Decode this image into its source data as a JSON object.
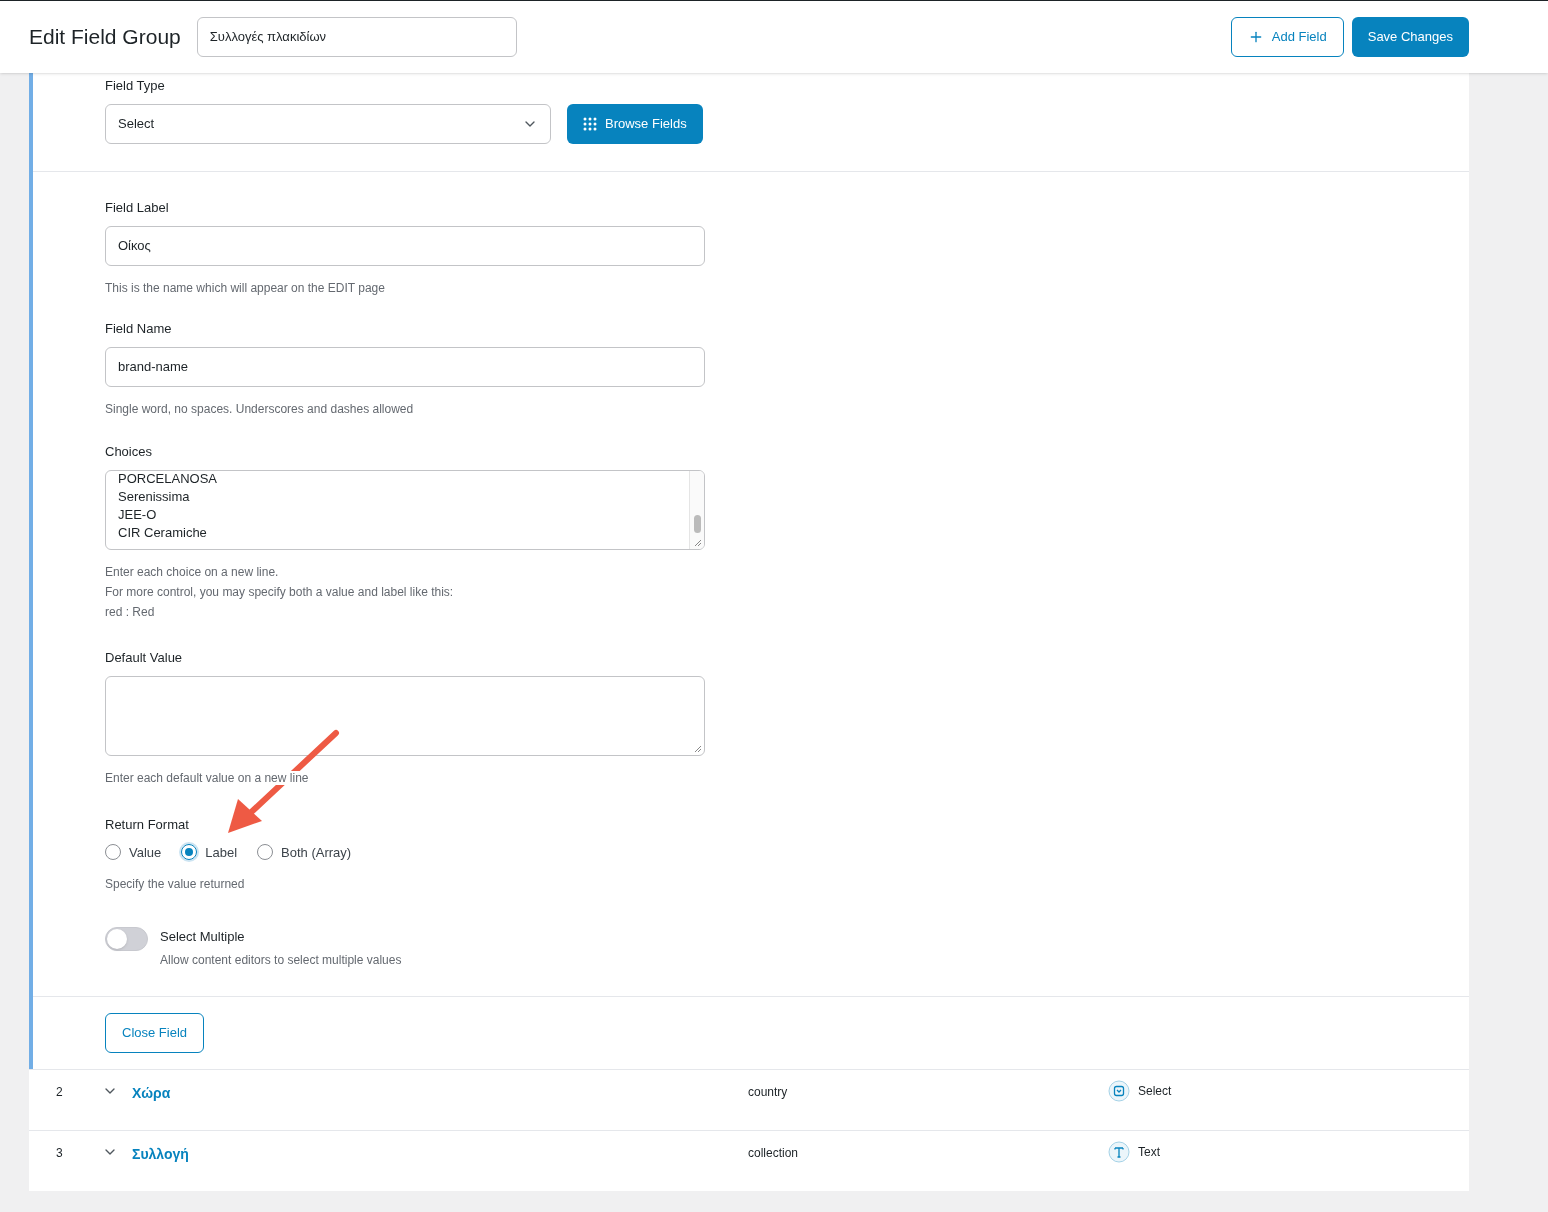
{
  "header": {
    "title": "Edit Field Group",
    "group_name": "Συλλογές πλακιδίων",
    "buttons": [
      {
        "label": "Add Field",
        "kind": "secondary"
      },
      {
        "label": "Save Changes",
        "kind": "primary"
      }
    ]
  },
  "field_type": {
    "label": "Field Type",
    "value": "Select",
    "browse_button": "Browse Fields"
  },
  "settings": [
    {
      "kind": "text",
      "label": "Field Label",
      "value": "Οίκος",
      "help": [
        "This is the name which will appear on the EDIT page"
      ]
    },
    {
      "kind": "text",
      "label": "Field Name",
      "value": "brand-name",
      "help": [
        "Single word, no spaces. Underscores and dashes allowed"
      ]
    },
    {
      "kind": "textarea",
      "label": "Choices",
      "lines": [
        "PORCELANOSA",
        "Serenissima",
        "JEE-O",
        "CIR Ceramiche"
      ],
      "help": [
        "Enter each choice on a new line.",
        "For more control, you may specify both a value and label like this:",
        "red : Red"
      ]
    },
    {
      "kind": "textarea",
      "label": "Default Value",
      "help": [
        "Enter each default value on a new line"
      ]
    },
    {
      "kind": "radio",
      "label": "Return Format",
      "options": [
        {
          "label": "Value",
          "selected": false
        },
        {
          "label": "Label",
          "selected": true
        },
        {
          "label": "Both (Array)",
          "selected": false
        }
      ],
      "help": [
        "Specify the value returned"
      ]
    },
    {
      "kind": "toggle",
      "label": "Select Multiple",
      "on": false,
      "help": [
        "Allow content editors to select multiple values"
      ]
    }
  ],
  "close_button": "Close Field",
  "fields": [
    {
      "order": "2",
      "label": "Χώρα",
      "name": "country",
      "type": "Select",
      "kind": "select"
    },
    {
      "order": "3",
      "label": "Συλλογή",
      "name": "collection",
      "type": "Text",
      "kind": "text"
    }
  ]
}
